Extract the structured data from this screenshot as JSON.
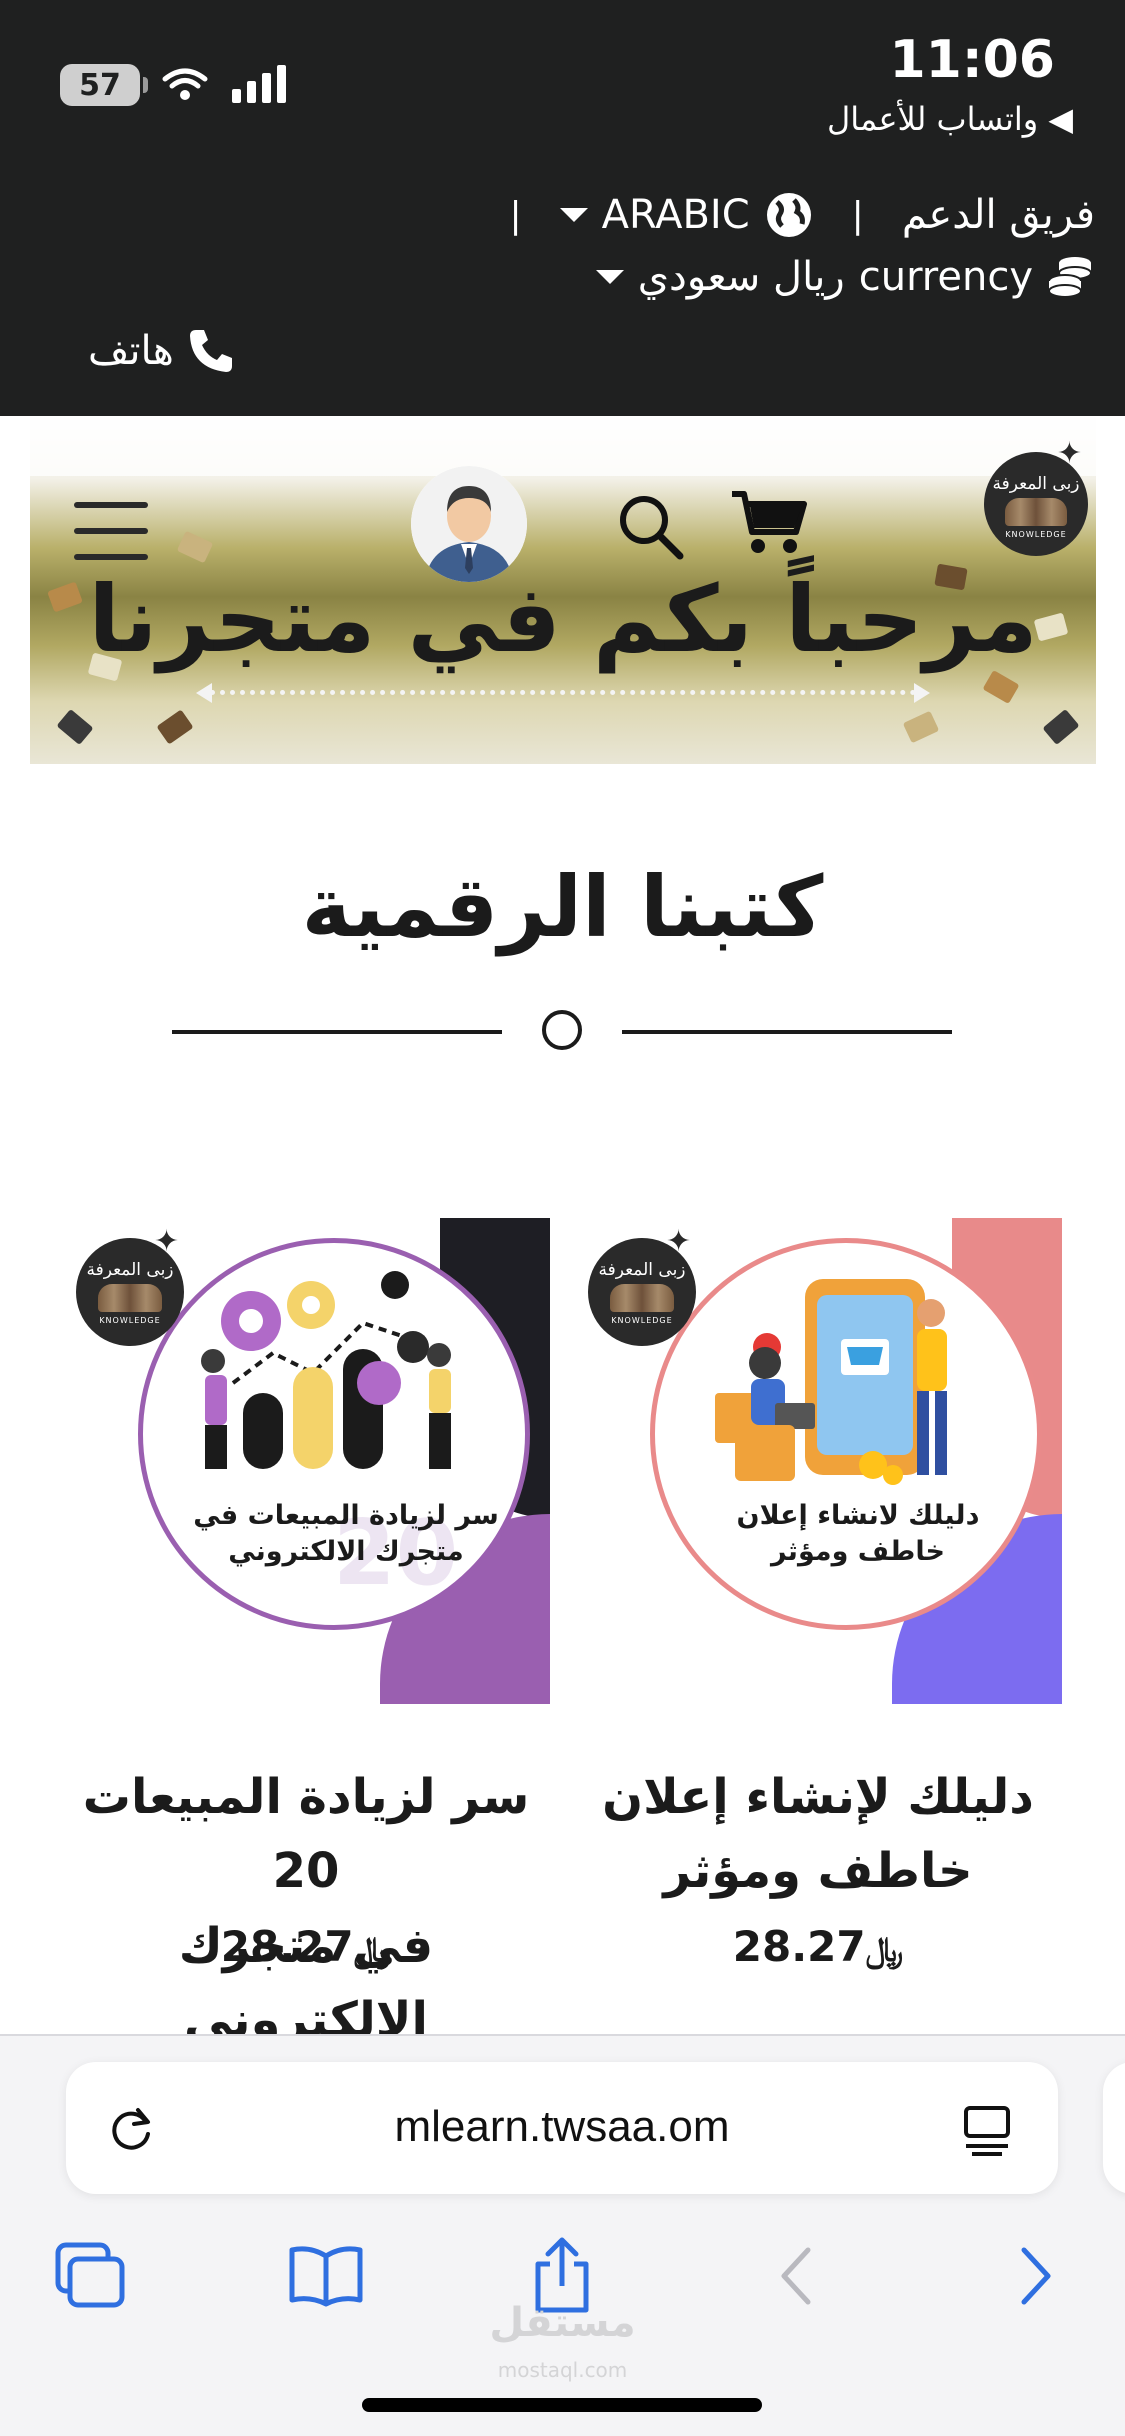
{
  "status_bar": {
    "time": "11:06",
    "back_app": "◀ واتساب للأعمال",
    "battery": "57"
  },
  "utility": {
    "support": "فريق الدعم",
    "separator": "|",
    "language": "ARABIC",
    "currency_label": "currency",
    "currency_value": "ريال سعودي",
    "phone": "هاتف"
  },
  "header": {
    "welcome": "مرحباً بكم في متجرنا",
    "logo_text": "زبى المعرفة",
    "logo_sub": "KNOWLEDGE"
  },
  "section": {
    "title": "كتبنا الرقمية"
  },
  "products": [
    {
      "title_line1": "دليلك لإنشاء إعلان",
      "title_line2": "خاطف ومؤثر",
      "price": "28.27",
      "currency_symbol": "﷼",
      "image_text": "دليلك لانشاء إعلان خاطف ومؤثر",
      "accent_top": "#e88a8a",
      "accent_bottom": "#7c6cf0",
      "ring": "#e98a8a"
    },
    {
      "title_line1": "سر لزيادة المبيعات 20",
      "title_line2": "في متجرك الالكتروني",
      "price": "28.27",
      "currency_symbol": "﷼",
      "image_text": "سر لزيادة المبيعات في متجرك الالكتروني",
      "image_number": "20",
      "accent_top": "#1e1e24",
      "accent_bottom": "#9a5fb0",
      "ring": "#9a5fb0"
    }
  ],
  "browser": {
    "url": "mlearn.twsaa.om"
  },
  "watermark": {
    "name": "مستقل",
    "domain": "mostaql.com"
  }
}
